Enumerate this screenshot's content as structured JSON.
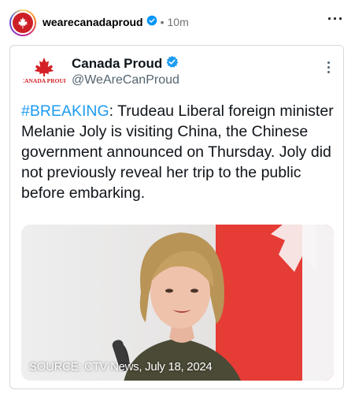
{
  "post": {
    "username": "wearecanadaproud",
    "dot": "•",
    "time": "10m",
    "more_label": "···"
  },
  "tweet": {
    "display_name": "Canada Proud",
    "handle": "@WeAreCanProud",
    "logo_text": "CANADA PROUD",
    "hashtag": "#BREAKING",
    "body": ": Trudeau Liberal foreign minister Melanie Joly is visiting China, the Chinese government announced on Thursday. Joly did not previously reveal her trip to the public before embarking.",
    "image_caption": "SOURCE: CTV News, July 18, 2024"
  },
  "colors": {
    "accent_blue": "#1d9bf0",
    "brand_red": "#cc1f25",
    "flag_red": "#e53c35"
  },
  "icons": {
    "verified": "verified-badge-icon",
    "more": "more-horizontal-icon",
    "card_more": "more-vertical-icon"
  }
}
